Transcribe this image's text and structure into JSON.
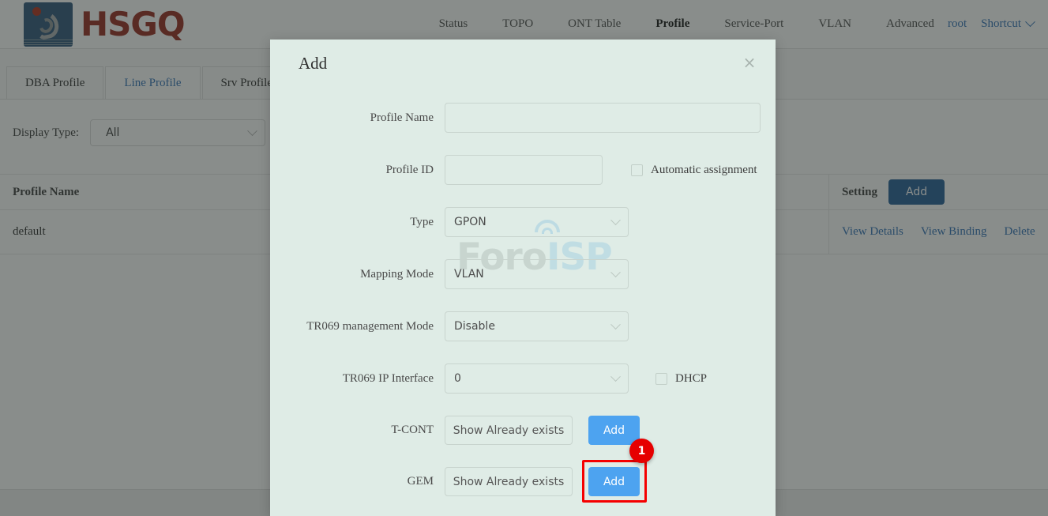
{
  "brand": {
    "name": "HSGQ"
  },
  "nav": {
    "items": [
      {
        "label": "Status",
        "active": false
      },
      {
        "label": "TOPO",
        "active": false
      },
      {
        "label": "ONT Table",
        "active": false
      },
      {
        "label": "Profile",
        "active": true
      },
      {
        "label": "Service-Port",
        "active": false
      },
      {
        "label": "VLAN",
        "active": false
      },
      {
        "label": "Advanced",
        "active": false
      }
    ],
    "user": "root",
    "shortcut": "Shortcut"
  },
  "tabs": [
    {
      "label": "DBA Profile",
      "active": false
    },
    {
      "label": "Line Profile",
      "active": true
    },
    {
      "label": "Srv Profile",
      "active": false
    },
    {
      "label": "",
      "active": false
    }
  ],
  "toolbar": {
    "display_type_label": "Display Type:",
    "display_type_value": "All"
  },
  "table": {
    "columns": [
      "Profile Name",
      "Setting"
    ],
    "header_add_label": "Add",
    "rows": [
      {
        "profile_name": "default",
        "actions": [
          "View Details",
          "View Binding",
          "Delete"
        ]
      }
    ]
  },
  "watermark": {
    "part1": "Foro",
    "part2": "ISP"
  },
  "dialog": {
    "title": "Add",
    "close_icon": "×",
    "fields": {
      "profile_name_label": "Profile Name",
      "profile_name_value": "",
      "profile_name_placeholder": "",
      "profile_id_label": "Profile ID",
      "profile_id_value": "",
      "profile_id_placeholder": "",
      "automatic_assignment_label": "Automatic assignment",
      "type_label": "Type",
      "type_value": "GPON",
      "mapping_mode_label": "Mapping Mode",
      "mapping_mode_value": "VLAN",
      "tr069_mode_label": "TR069 management Mode",
      "tr069_mode_value": "Disable",
      "tr069_ip_label": "TR069 IP Interface",
      "tr069_ip_value": "0",
      "dhcp_label": "DHCP",
      "tcont_label": "T-CONT",
      "tcont_show_label": "Show Already exists",
      "tcont_add_label": "Add",
      "gem_label": "GEM",
      "gem_show_label": "Show Already exists",
      "gem_add_label": "Add"
    },
    "highlight_badge": "1"
  },
  "colors": {
    "brand_red": "#96261c",
    "brand_blue": "#2c5279",
    "link_blue": "#2f6fb5",
    "button_blue": "#4da3f0",
    "button_dark_blue": "#1f5b96",
    "highlight_red": "#f50000",
    "dialog_bg": "#dfece6"
  }
}
